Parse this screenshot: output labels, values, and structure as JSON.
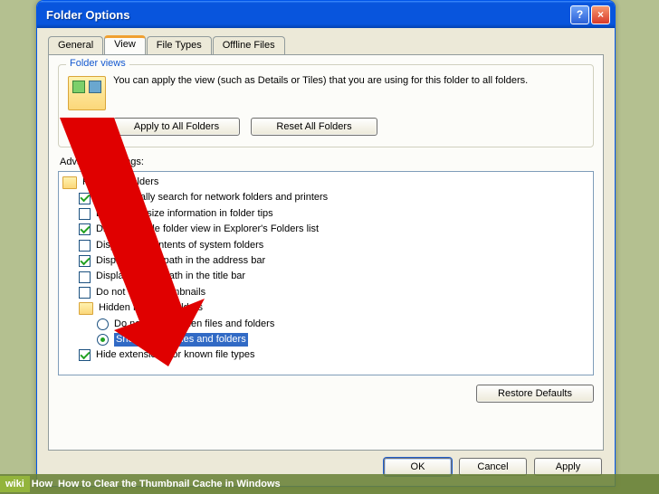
{
  "dialog": {
    "title": "Folder Options",
    "help_label": "?",
    "close_label": "×"
  },
  "tabs": [
    {
      "label": "General"
    },
    {
      "label": "View"
    },
    {
      "label": "File Types"
    },
    {
      "label": "Offline Files"
    }
  ],
  "folder_views": {
    "legend": "Folder views",
    "text": "You can apply the view (such as Details or Tiles) that you are using for this folder to all folders.",
    "apply_button": "Apply to All Folders",
    "reset_button": "Reset All Folders"
  },
  "advanced": {
    "label": "Advanced settings:",
    "root": "Files and Folders",
    "items": [
      {
        "type": "check",
        "checked": true,
        "label": "Automatically search for network folders and printers"
      },
      {
        "type": "check",
        "checked": false,
        "label": "Display file size information in folder tips"
      },
      {
        "type": "check",
        "checked": true,
        "label": "Display simple folder view in Explorer's Folders list"
      },
      {
        "type": "check",
        "checked": false,
        "label": "Display the contents of system folders"
      },
      {
        "type": "check",
        "checked": true,
        "label": "Display the full path in the address bar"
      },
      {
        "type": "check",
        "checked": false,
        "label": "Display the full path in the title bar"
      },
      {
        "type": "check",
        "checked": false,
        "label": "Do not cache thumbnails"
      },
      {
        "type": "folder",
        "label": "Hidden files and folders"
      },
      {
        "type": "radio",
        "checked": false,
        "indent": 2,
        "label": "Do not show hidden files and folders"
      },
      {
        "type": "radio",
        "checked": true,
        "indent": 2,
        "label": "Show hidden files and folders",
        "selected": true
      },
      {
        "type": "check",
        "checked": true,
        "label": "Hide extensions for known file types"
      }
    ],
    "restore_button": "Restore Defaults"
  },
  "buttons": {
    "ok": "OK",
    "cancel": "Cancel",
    "apply": "Apply"
  },
  "banner": {
    "wiki": "wiki",
    "how": "How",
    "text": "How to Clear the Thumbnail Cache in Windows"
  }
}
